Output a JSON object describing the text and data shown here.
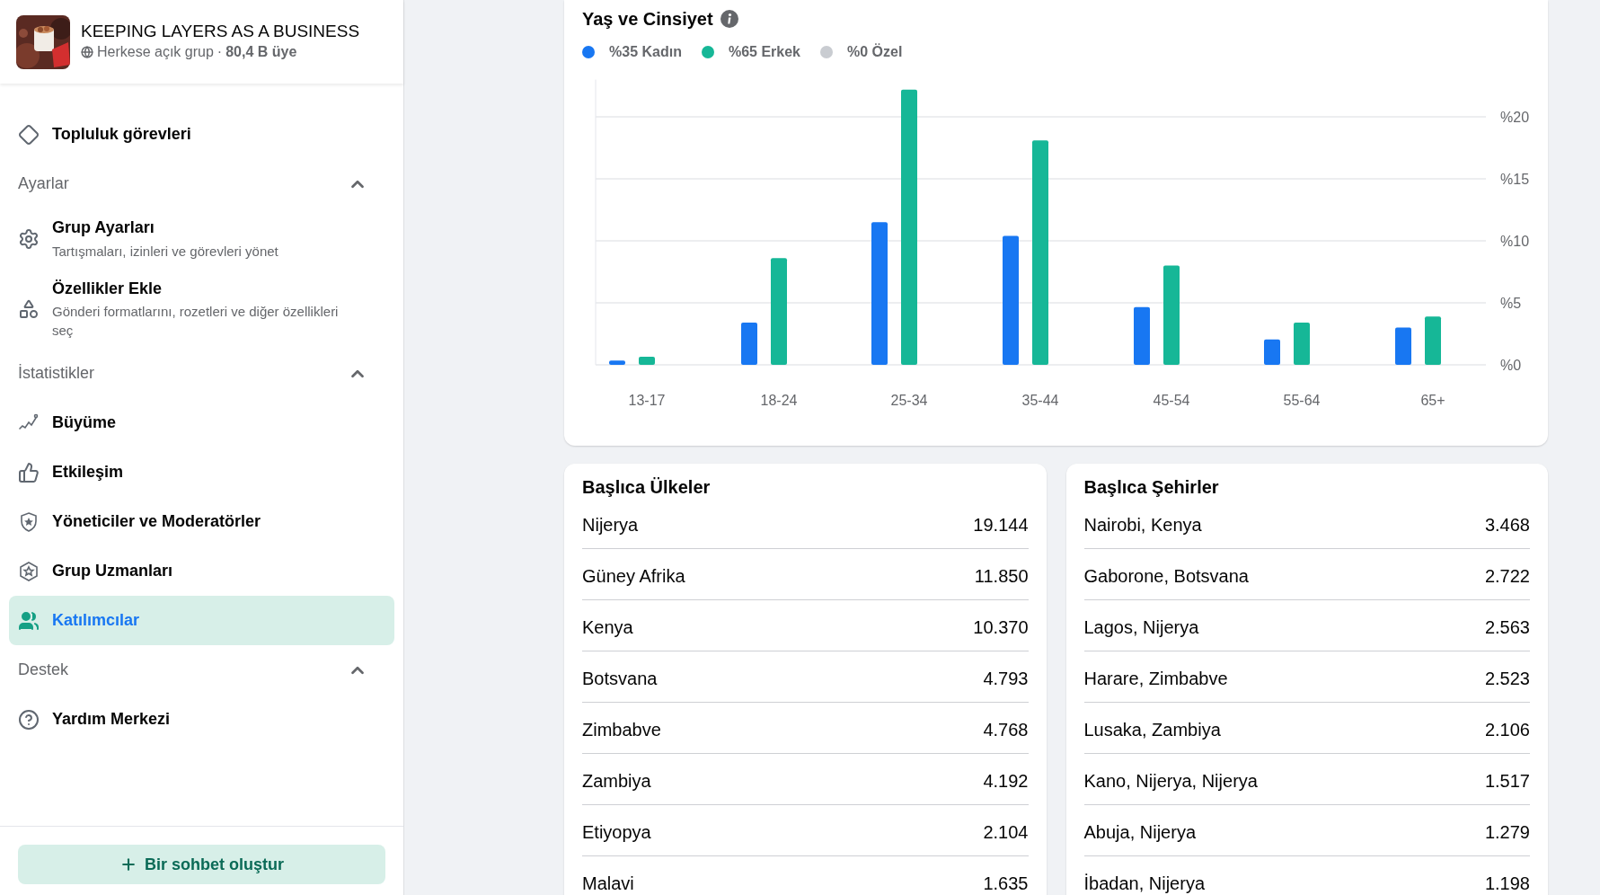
{
  "sidebar": {
    "group": {
      "name": "KEEPING LAYERS AS A BUSINESS",
      "privacy": "Herkese açık grup",
      "separator": "·",
      "members": "80,4 B üye"
    },
    "items": [
      {
        "kind": "link",
        "label": "Topluluk görevleri",
        "selected": false
      },
      {
        "kind": "heading",
        "label": "Ayarlar",
        "expanded": true
      },
      {
        "kind": "link",
        "label": "Grup Ayarları",
        "description": "Tartışmaları, izinleri ve görevleri yönet",
        "selected": false
      },
      {
        "kind": "link",
        "label": "Özellikler Ekle",
        "description": "Gönderi formatlarını, rozetleri ve diğer özellikleri seç",
        "selected": false
      },
      {
        "kind": "heading",
        "label": "İstatistikler",
        "expanded": true
      },
      {
        "kind": "link",
        "label": "Büyüme",
        "selected": false
      },
      {
        "kind": "link",
        "label": "Etkileşim",
        "selected": false
      },
      {
        "kind": "link",
        "label": "Yöneticiler ve Moderatörler",
        "selected": false
      },
      {
        "kind": "link",
        "label": "Grup Uzmanları",
        "selected": false
      },
      {
        "kind": "link",
        "label": "Katılımcılar",
        "selected": true
      },
      {
        "kind": "heading",
        "label": "Destek",
        "expanded": true
      },
      {
        "kind": "link",
        "label": "Yardım Merkezi",
        "selected": false
      }
    ],
    "create_button": {
      "label": "Bir sohbet oluştur"
    }
  },
  "age_gender": {
    "title": "Yaş ve Cinsiyet",
    "chart_data": {
      "type": "bar",
      "grid": true,
      "categories": [
        "13-17",
        "18-24",
        "25-34",
        "35-44",
        "45-54",
        "55-64",
        "65+"
      ],
      "series": [
        {
          "name": "%35 Kadın",
          "color": "#1877f2",
          "values": [
            0.35,
            3.4,
            11.5,
            10.4,
            4.65,
            2.05,
            3.0
          ]
        },
        {
          "name": "%65 Erkek",
          "color": "#16b797",
          "values": [
            0.65,
            8.6,
            22.2,
            18.1,
            8.0,
            3.4,
            3.9
          ]
        },
        {
          "name": "%0 Özel",
          "color": "#c9ccd1",
          "values": [
            0,
            0,
            0,
            0,
            0,
            0,
            0
          ]
        }
      ],
      "ylim": [
        0,
        23
      ],
      "yticks": [
        {
          "value": 0,
          "label": "%0"
        },
        {
          "value": 5,
          "label": "%5"
        },
        {
          "value": 10,
          "label": "%10"
        },
        {
          "value": 15,
          "label": "%15"
        },
        {
          "value": 20,
          "label": "%20"
        }
      ]
    }
  },
  "top_countries": {
    "title": "Başlıca Ülkeler",
    "rows": [
      {
        "name": "Nijerya",
        "count": "19.144"
      },
      {
        "name": "Güney Afrika",
        "count": "11.850"
      },
      {
        "name": "Kenya",
        "count": "10.370"
      },
      {
        "name": "Botsvana",
        "count": "4.793"
      },
      {
        "name": "Zimbabve",
        "count": "4.768"
      },
      {
        "name": "Zambiya",
        "count": "4.192"
      },
      {
        "name": "Etiyopya",
        "count": "2.104"
      },
      {
        "name": "Malavi",
        "count": "1.635"
      }
    ]
  },
  "top_cities": {
    "title": "Başlıca Şehirler",
    "rows": [
      {
        "name": "Nairobi, Kenya",
        "count": "3.468"
      },
      {
        "name": "Gaborone, Botsvana",
        "count": "2.722"
      },
      {
        "name": "Lagos, Nijerya",
        "count": "2.563"
      },
      {
        "name": "Harare, Zimbabve",
        "count": "2.523"
      },
      {
        "name": "Lusaka, Zambiya",
        "count": "2.106"
      },
      {
        "name": "Kano, Nijerya, Nijerya",
        "count": "1.517"
      },
      {
        "name": "Abuja, Nijerya",
        "count": "1.279"
      },
      {
        "name": "İbadan, Nijerya",
        "count": "1.198"
      }
    ]
  }
}
